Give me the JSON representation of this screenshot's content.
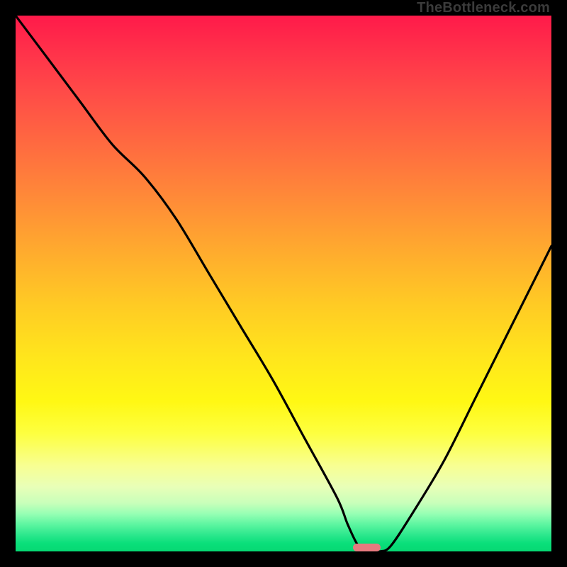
{
  "watermark": "TheBottleneck.com",
  "marker": {
    "x_pct": 65.5,
    "width_pct": 5.2,
    "thickness_px": 11,
    "color": "#e77a7f"
  },
  "chart_data": {
    "type": "line",
    "title": "",
    "xlabel": "",
    "ylabel": "",
    "xlim": [
      0,
      100
    ],
    "ylim": [
      0,
      100
    ],
    "grid": false,
    "legend": false,
    "note": "No tick labels are rendered; values are visual estimates on a 0–100 scale.",
    "series": [
      {
        "name": "bottleneck-curve",
        "x": [
          0,
          6,
          12,
          18,
          24,
          30,
          36,
          42,
          48,
          54,
          60,
          62,
          64,
          66,
          68,
          70,
          74,
          80,
          86,
          92,
          98,
          100
        ],
        "y": [
          100,
          92,
          84,
          76,
          70,
          62,
          52,
          42,
          32,
          21,
          10,
          5,
          1,
          0,
          0,
          1,
          7,
          17,
          29,
          41,
          53,
          57
        ]
      }
    ],
    "optimum_region": {
      "x_start": 63,
      "x_end": 68,
      "y": 0
    }
  }
}
